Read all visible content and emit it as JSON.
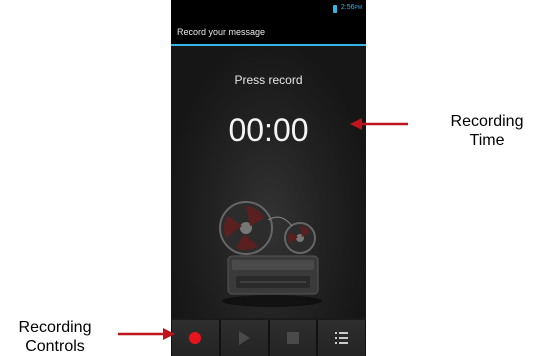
{
  "status_bar": {
    "time": "2:56",
    "ampm": "PM"
  },
  "action_bar": {
    "title": "Record your message"
  },
  "main": {
    "prompt": "Press record",
    "timer": "00:00"
  },
  "controls": {
    "record_icon": "record-icon",
    "play_icon": "play-icon",
    "stop_icon": "stop-icon",
    "list_icon": "list-icon"
  },
  "annotations": {
    "time_label_line1": "Recording",
    "time_label_line2": "Time",
    "controls_label_line1": "Recording",
    "controls_label_line2": "Controls"
  },
  "colors": {
    "accent": "#33b5e5",
    "record": "#e8141c",
    "arrow": "#c0141c"
  }
}
